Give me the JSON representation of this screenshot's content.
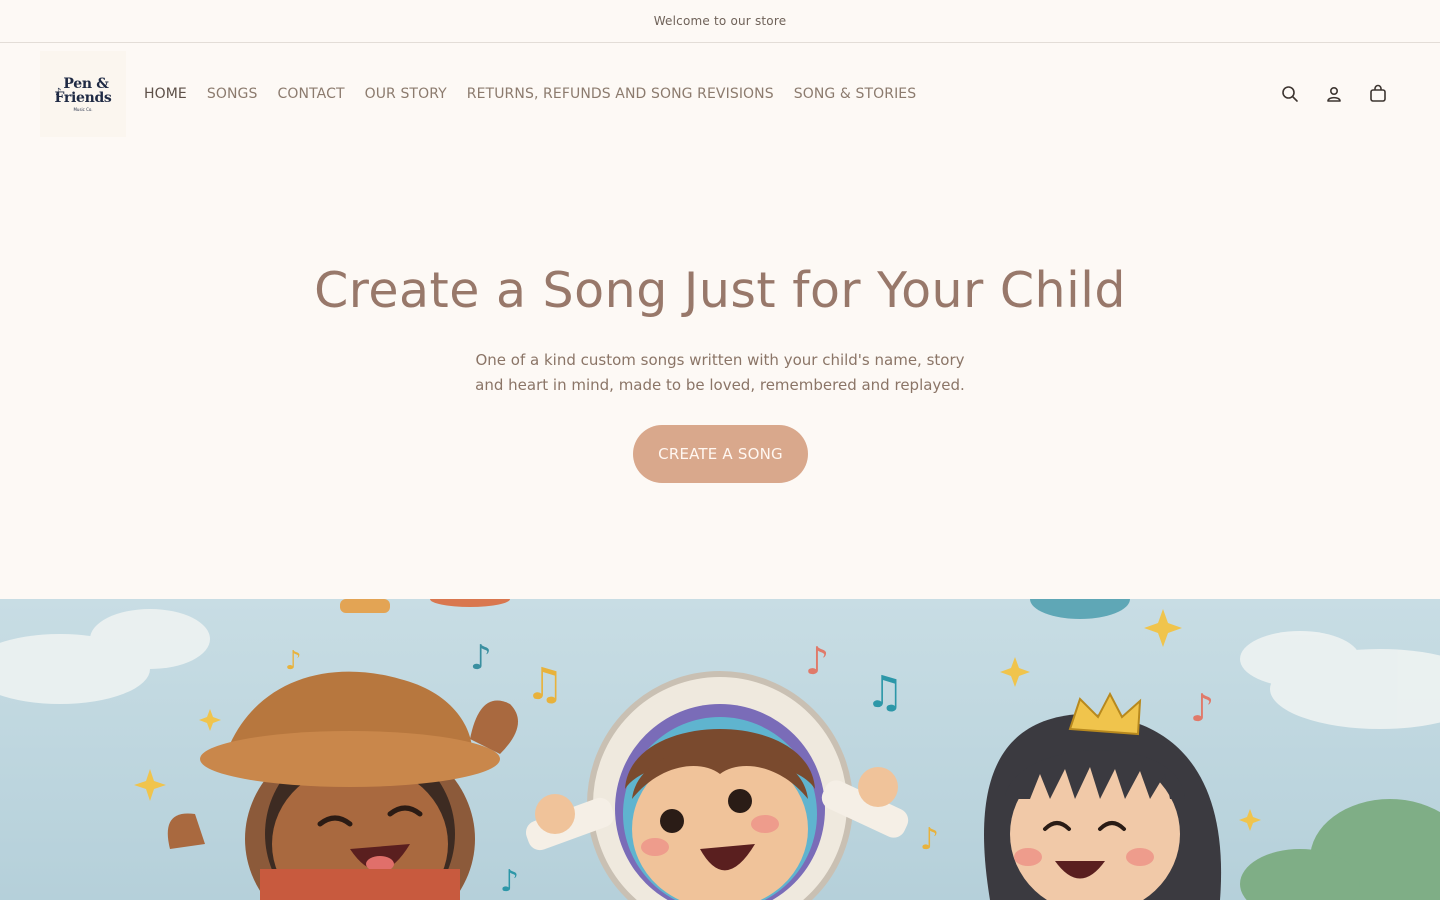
{
  "announcement": {
    "text": "Welcome to our store"
  },
  "header": {
    "logo": {
      "line1": "Pen &",
      "line2": "Friends",
      "sub": "Music Co."
    },
    "nav": [
      {
        "label": "HOME",
        "active": true
      },
      {
        "label": "SONGS"
      },
      {
        "label": "CONTACT"
      },
      {
        "label": "OUR STORY"
      },
      {
        "label": "RETURNS, REFUNDS AND SONG REVISIONS"
      },
      {
        "label": "SONG & STORIES"
      }
    ],
    "icons": [
      "search-icon",
      "account-icon",
      "cart-icon"
    ]
  },
  "hero": {
    "title": "Create a Song Just for Your Child",
    "subtitle": "One of a kind custom songs written with your child's name, story and heart in mind, made to be loved, remembered and replayed.",
    "cta_label": "CREATE A SONG"
  },
  "colors": {
    "background": "#fdf9f5",
    "title": "#98786a",
    "cta": "#d9a88c",
    "sky": "#bcd3dc"
  },
  "banner": {
    "description_icons": [
      "cowboy-child",
      "astronaut-child",
      "princess-child",
      "music-notes"
    ]
  }
}
